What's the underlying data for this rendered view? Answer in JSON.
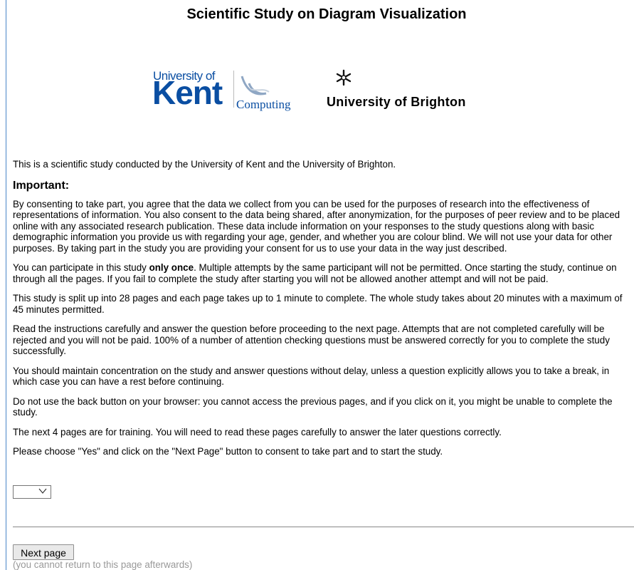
{
  "title": "Scientific Study on Diagram Visualization",
  "logos": {
    "kent_top": "University of",
    "kent_main": "Kent",
    "kent_sub": "Computing",
    "brighton": "University of Brighton"
  },
  "intro": "This is a scientific study conducted by the University of Kent and the University of Brighton.",
  "important_heading": "Important:",
  "paragraphs": {
    "consent": "By consenting to take part, you agree that the data we collect from you can be used for the purposes of research into the effectiveness of representations of information. You also consent to the data being shared, after anonymization, for the purposes of peer review and to be placed online with any associated research publication. These data include information on your responses to the study questions along with basic demographic information you provide us with regarding your age, gender, and whether you are colour blind. We will not use your data for other purposes. By taking part in the study you are providing your consent for us to use your data in the way just described.",
    "once_before": "You can participate in this study ",
    "once_bold": "only once",
    "once_after": ". Multiple attempts by the same participant will not be permitted. Once starting the study, continue on through all the pages. If you fail to complete the study after starting you will not be allowed another attempt and will not be paid.",
    "split": "This study is split up into 28 pages and each page takes up to 1 minute to complete. The whole study takes about 20 minutes with a maximum of 45 minutes permitted.",
    "instructions": "Read the instructions carefully and answer the question before proceeding to the next page. Attempts that are not completed carefully will be rejected and you will not be paid. 100% of a number of attention checking questions must be answered correctly for you to complete the study successfully.",
    "concentration": "You should maintain concentration on the study and answer questions without delay, unless a question explicitly allows you to take a break, in which case you can have a rest before continuing.",
    "back_button": "Do not use the back button on your browser: you cannot access the previous pages, and if you click on it, you might be unable to complete the study.",
    "training": "The next 4 pages are for training. You will need to read these pages carefully to answer the later questions correctly.",
    "choose": "Please choose \"Yes\" and click on the \"Next Page\" button to consent to take part and to start the study."
  },
  "consent_select": {
    "selected": "",
    "icon": "chevron-down-icon"
  },
  "next_button": "Next page",
  "next_note": "(you cannot return to this page afterwards)"
}
